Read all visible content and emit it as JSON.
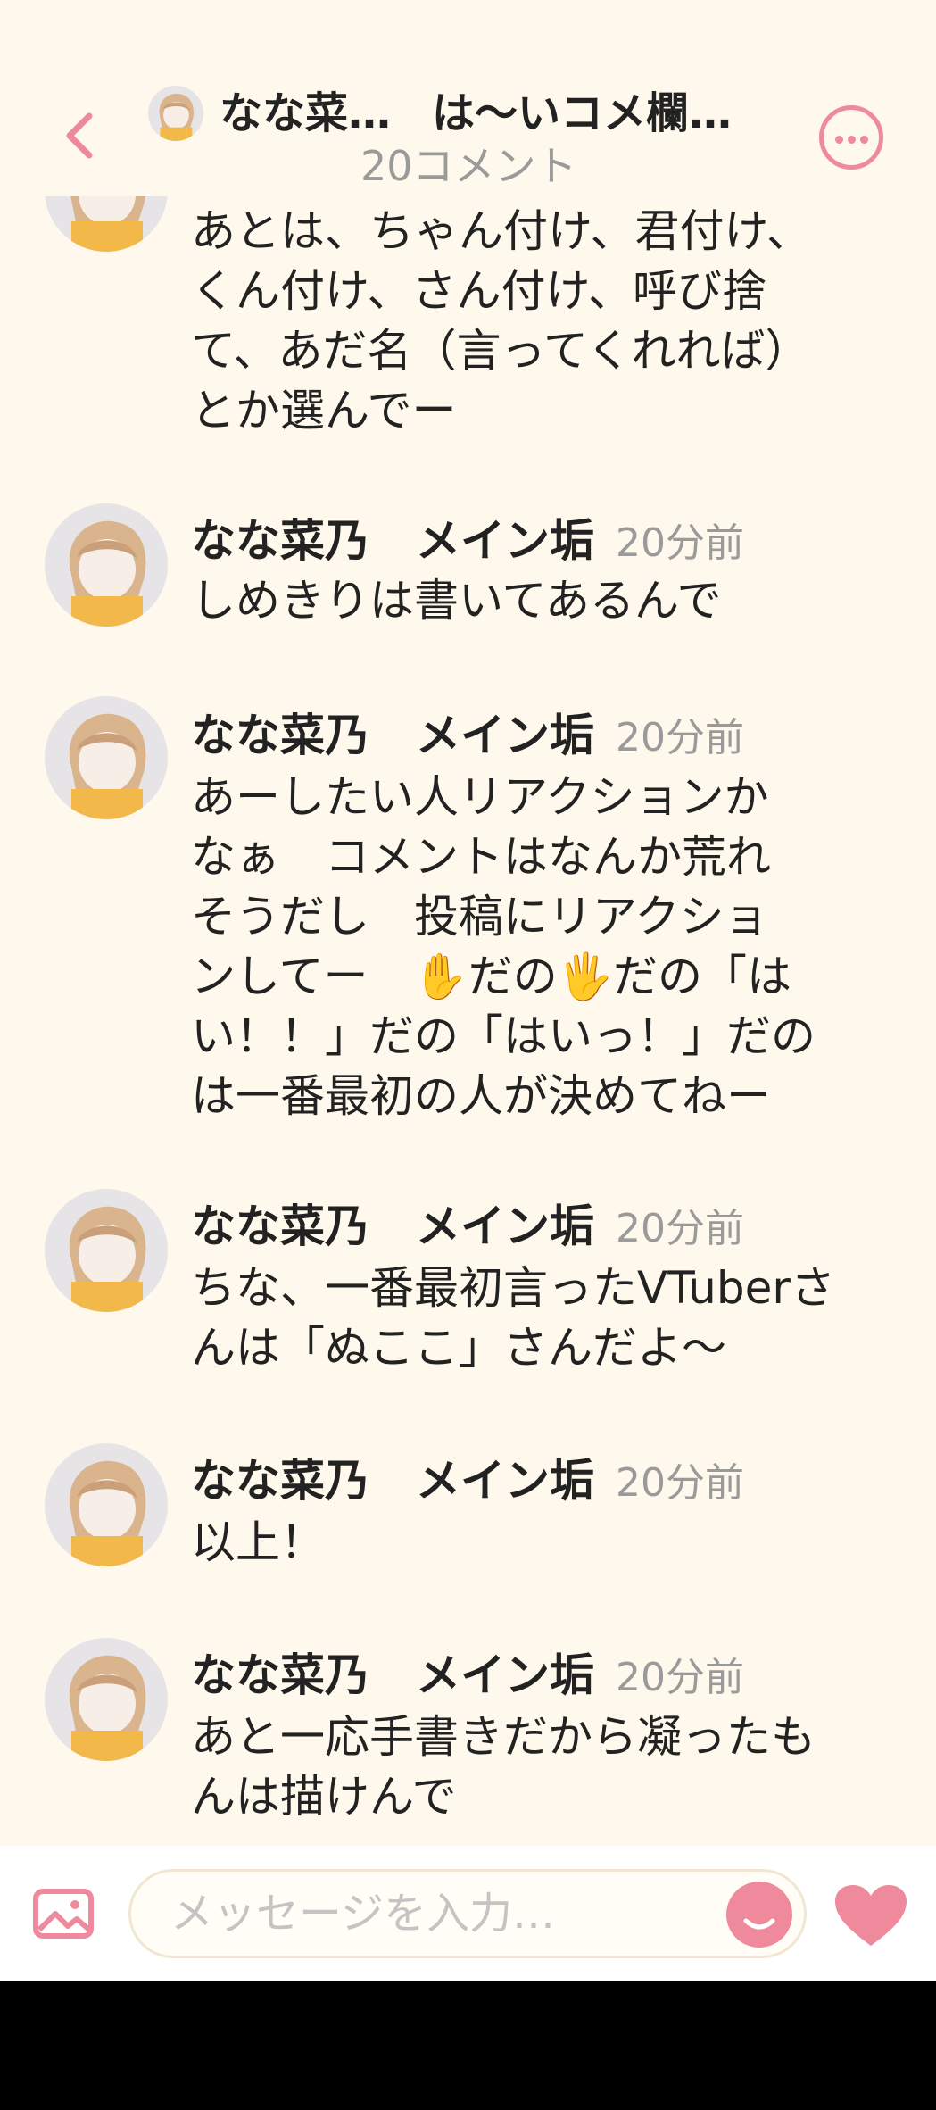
{
  "header": {
    "channel_name": "なな菜…",
    "thread_title": "は〜いコメ欄…",
    "comment_count": "20コメント"
  },
  "messages": [
    {
      "name": "",
      "time": "",
      "lines": [
        "あとは、ちゃん付け、君付け、",
        "くん付け、さん付け、呼び捨",
        "て、あだ名（言ってくれれば）",
        "とか選んでー"
      ]
    },
    {
      "name_first": "なな菜乃",
      "name_second": "メイン垢",
      "time": "20分前",
      "lines": [
        "しめきりは書いてあるんで"
      ]
    },
    {
      "name_first": "なな菜乃",
      "name_second": "メイン垢",
      "time": "20分前",
      "lines": [
        "あーしたい人リアクションか",
        "なぁ　コメントはなんか荒れ",
        "そうだし　投稿にリアクショ",
        "ンしてー　✋だの🖐だの「は",
        "い！！」だの「はいっ！」だの",
        "は一番最初の人が決めてねー"
      ]
    },
    {
      "name_first": "なな菜乃",
      "name_second": "メイン垢",
      "time": "20分前",
      "lines": [
        "ちな、一番最初言ったVTuberさ",
        "んは「ぬここ」さんだよ〜"
      ]
    },
    {
      "name_first": "なな菜乃",
      "name_second": "メイン垢",
      "time": "20分前",
      "lines": [
        "以上！"
      ]
    },
    {
      "name_first": "なな菜乃",
      "name_second": "メイン垢",
      "time": "20分前",
      "lines": [
        "あと一応手書きだから凝ったも",
        "んは描けんで"
      ]
    }
  ],
  "input": {
    "placeholder": "メッセージを入力…"
  },
  "icons": {
    "back": "chevron-left-icon",
    "more": "more-horizontal-icon",
    "image": "image-icon",
    "emoji": "smile-icon",
    "heart": "heart-icon"
  },
  "colors": {
    "background": "#fef9ec",
    "accent": "#ee8a9c",
    "muted_text": "#9a9a9a"
  }
}
